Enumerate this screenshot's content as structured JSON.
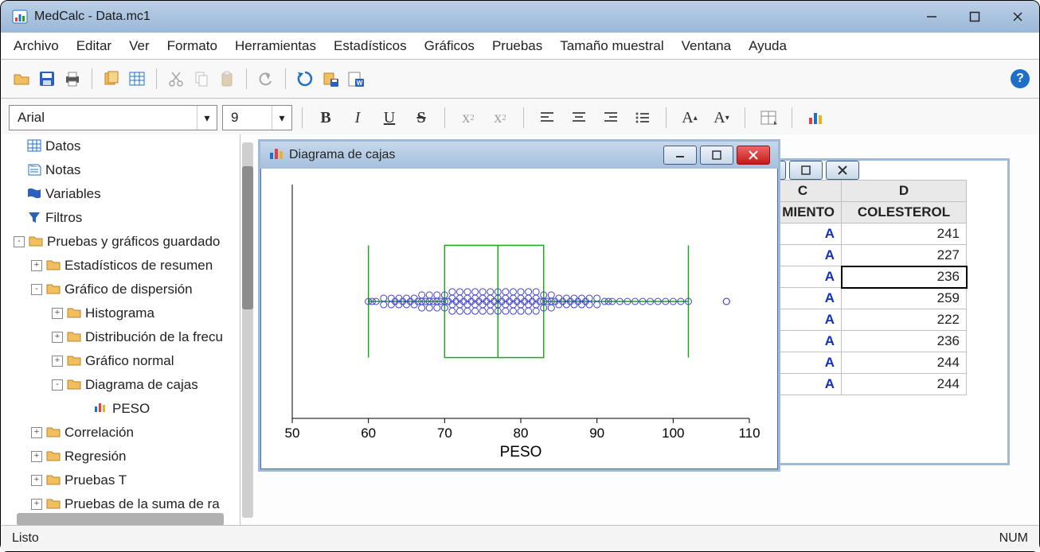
{
  "window": {
    "title": "MedCalc - Data.mc1"
  },
  "menus": [
    "Archivo",
    "Editar",
    "Ver",
    "Formato",
    "Herramientas",
    "Estadísticos",
    "Gráficos",
    "Pruebas",
    "Tamaño muestral",
    "Ventana",
    "Ayuda"
  ],
  "font_combo": {
    "name": "Arial",
    "size": "9"
  },
  "tree": {
    "items": [
      {
        "label": "Datos",
        "icon": "grid",
        "indent": 0,
        "exp": ""
      },
      {
        "label": "Notas",
        "icon": "notes",
        "indent": 0,
        "exp": ""
      },
      {
        "label": "Variables",
        "icon": "vars",
        "indent": 0,
        "exp": ""
      },
      {
        "label": "Filtros",
        "icon": "funnel",
        "indent": 0,
        "exp": ""
      },
      {
        "label": "Pruebas y gráficos guardado",
        "icon": "folder",
        "indent": 0,
        "exp": "-"
      },
      {
        "label": "Estadísticos de resumen",
        "icon": "folder",
        "indent": 1,
        "exp": "+"
      },
      {
        "label": "Gráfico de dispersión",
        "icon": "folder",
        "indent": 1,
        "exp": "-"
      },
      {
        "label": "Histograma",
        "icon": "folder",
        "indent": 2,
        "exp": "+"
      },
      {
        "label": "Distribución de la frecu",
        "icon": "folder",
        "indent": 2,
        "exp": "+"
      },
      {
        "label": "Gráfico normal",
        "icon": "folder",
        "indent": 2,
        "exp": "+"
      },
      {
        "label": "Diagrama de cajas",
        "icon": "folder",
        "indent": 2,
        "exp": "-"
      },
      {
        "label": "PESO",
        "icon": "chart",
        "indent": 3,
        "exp": ""
      },
      {
        "label": "Correlación",
        "icon": "folder",
        "indent": 1,
        "exp": "+"
      },
      {
        "label": "Regresión",
        "icon": "folder",
        "indent": 1,
        "exp": "+"
      },
      {
        "label": "Pruebas T",
        "icon": "folder",
        "indent": 1,
        "exp": "+"
      },
      {
        "label": "Pruebas de la suma de ra",
        "icon": "folder",
        "indent": 1,
        "exp": "+"
      }
    ]
  },
  "chart_window": {
    "title": "Diagrama de cajas"
  },
  "chart_data": {
    "type": "boxplot",
    "title": "",
    "xlabel": "PESO",
    "ylabel": "",
    "xlim": [
      50,
      110
    ],
    "xticks": [
      50,
      60,
      70,
      80,
      90,
      100,
      110
    ],
    "box": {
      "q1": 70,
      "median": 77,
      "q3": 83,
      "whisker_low": 60,
      "whisker_high": 102
    },
    "outliers": [
      107
    ],
    "points": [
      60,
      60.5,
      61,
      62,
      62,
      63,
      63,
      63.5,
      64,
      64,
      64.5,
      65,
      65,
      65.5,
      66,
      66,
      66.5,
      67,
      67,
      67,
      67.5,
      68,
      68,
      68,
      68.5,
      69,
      69,
      69,
      69.5,
      70,
      70,
      70,
      70.5,
      71,
      71,
      71,
      71,
      71.5,
      72,
      72,
      72,
      72,
      72.5,
      73,
      73,
      73,
      73,
      73.5,
      74,
      74,
      74,
      74,
      74.5,
      75,
      75,
      75,
      75,
      75.5,
      76,
      76,
      76,
      76,
      76.5,
      77,
      77,
      77,
      77,
      77.5,
      78,
      78,
      78,
      78,
      78.5,
      79,
      79,
      79,
      79,
      79.5,
      80,
      80,
      80,
      80,
      80.5,
      81,
      81,
      81,
      81,
      81.5,
      82,
      82,
      82,
      82,
      82.5,
      83,
      83,
      83,
      83.5,
      84,
      84,
      84,
      84.5,
      85,
      85,
      85.5,
      86,
      86,
      86.5,
      87,
      87,
      87.5,
      88,
      88,
      88.5,
      89,
      89,
      90,
      90,
      91,
      91.5,
      92,
      93,
      94,
      95,
      96,
      97,
      98,
      99,
      100,
      101,
      102,
      107
    ]
  },
  "data_grid": {
    "col_c_hdr": "C",
    "col_d_hdr": "D",
    "col_c_sub": "MIENTO",
    "col_d_sub": "COLESTEROL",
    "rows": [
      {
        "c": "A",
        "d": "241"
      },
      {
        "c": "A",
        "d": "227"
      },
      {
        "c": "A",
        "d": "236",
        "selected": true
      },
      {
        "c": "A",
        "d": "259"
      },
      {
        "c": "A",
        "d": "222"
      },
      {
        "c": "A",
        "d": "236"
      },
      {
        "c": "A",
        "d": "244"
      },
      {
        "c": "A",
        "d": "244"
      }
    ]
  },
  "status": {
    "left": "Listo",
    "right": "NUM"
  }
}
